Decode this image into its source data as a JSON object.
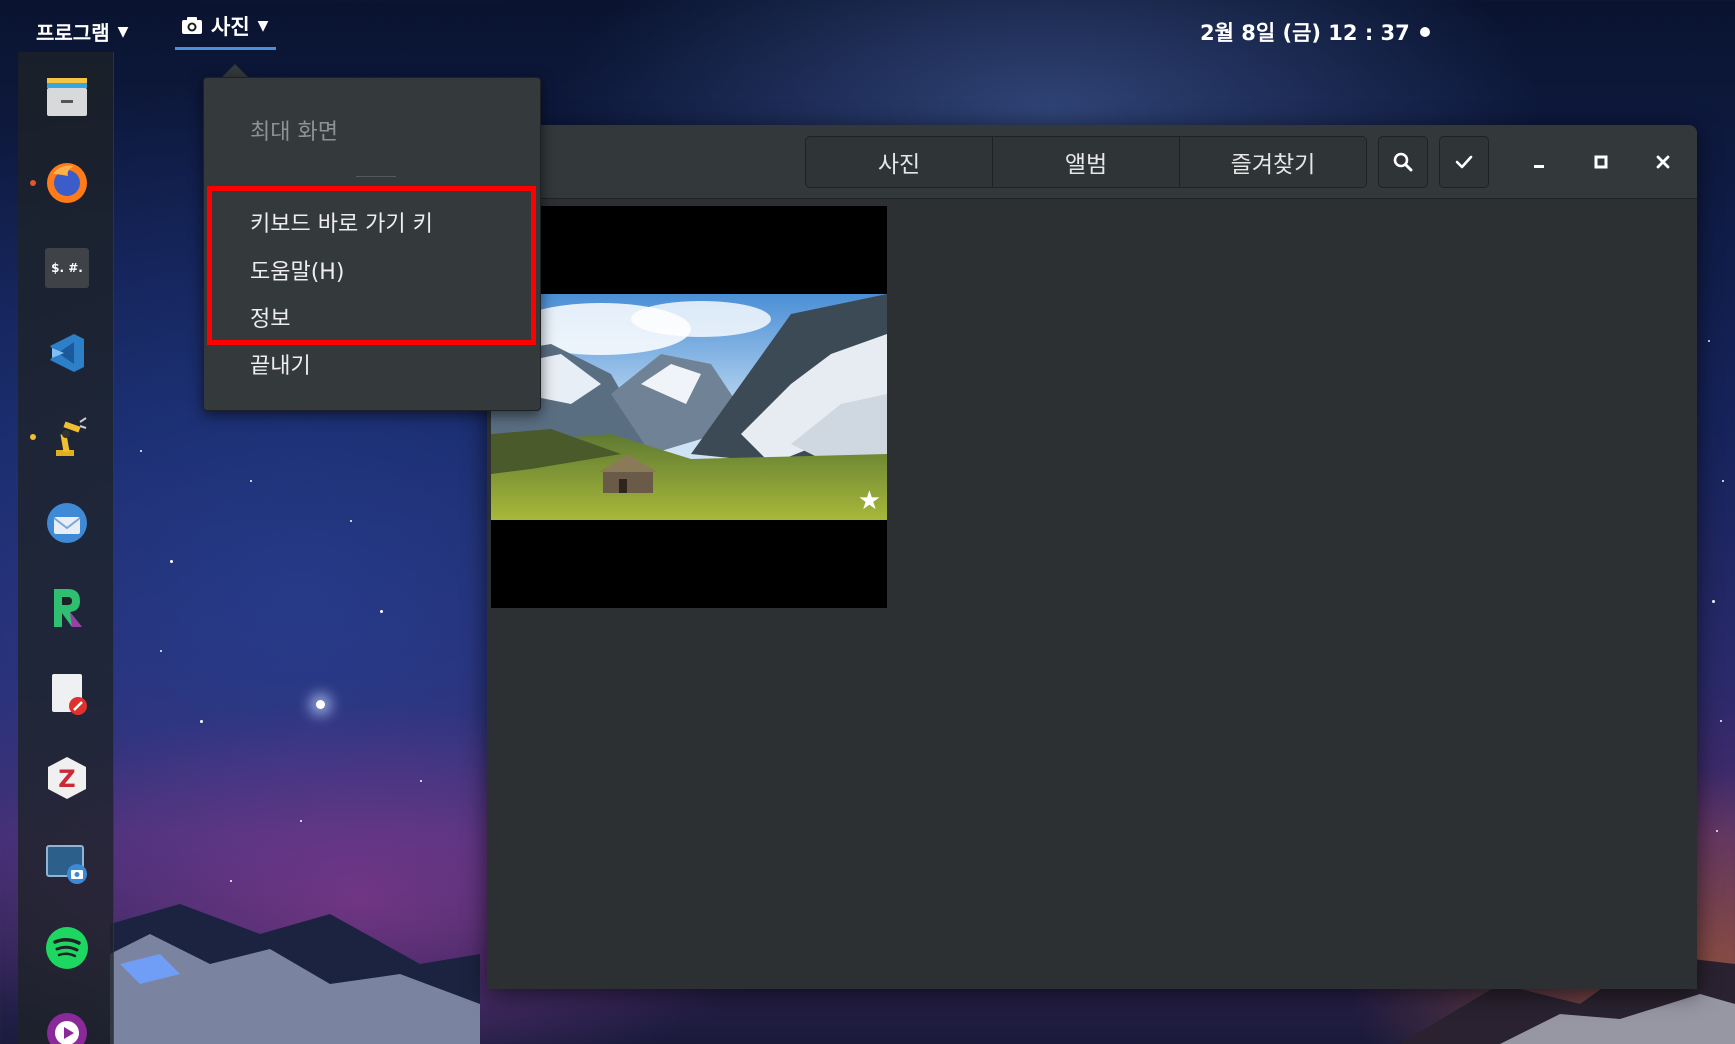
{
  "topbar": {
    "activities_label": "프로그램",
    "app_menu_label": "사진",
    "clock": "2월 8일 (금) 12 : 37"
  },
  "dock": {
    "items": [
      {
        "name": "files-icon"
      },
      {
        "name": "firefox-icon"
      },
      {
        "name": "calculator-icon",
        "label": "$. #."
      },
      {
        "name": "vscode-icon"
      },
      {
        "name": "robot-arm-icon"
      },
      {
        "name": "thunderbird-icon"
      },
      {
        "name": "rstudio-icon"
      },
      {
        "name": "text-editor-icon"
      },
      {
        "name": "zotero-icon",
        "label": "Z"
      },
      {
        "name": "screenshot-icon"
      },
      {
        "name": "spotify-icon"
      },
      {
        "name": "media-player-icon"
      }
    ]
  },
  "app_menu": {
    "items": [
      {
        "label": "최대 화면",
        "enabled": false
      },
      {
        "label": "키보드 바로 가기 키",
        "enabled": true
      },
      {
        "label": "도움말(H)",
        "enabled": true
      },
      {
        "label": "정보",
        "enabled": true
      },
      {
        "label": "끝내기",
        "enabled": true
      }
    ]
  },
  "window": {
    "tabs": [
      {
        "label": "사진"
      },
      {
        "label": "앨범"
      },
      {
        "label": "즐겨찾기"
      }
    ]
  },
  "colors": {
    "highlight": "#ff0000",
    "window_bg": "#2c3032",
    "headerbar_bg": "#33383a",
    "menu_bg": "#34393b"
  }
}
